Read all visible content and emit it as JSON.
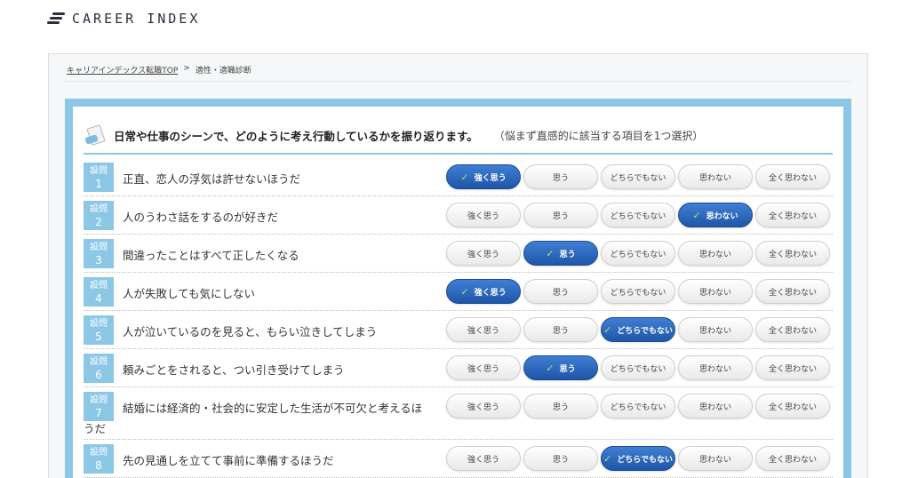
{
  "header": {
    "logo_text": "CAREER INDEX",
    "logo_icon": "stripes-logo-icon"
  },
  "breadcrumb": {
    "home": "キャリアインデックス転職TOP",
    "separator": ">",
    "current": "適性・適職診断"
  },
  "intro": {
    "icon": "notepad-icon",
    "main": "日常や仕事のシーンで、どのように考え行動しているかを振り返ります。",
    "sub": "（悩まず直感的に該当する項目を1つ選択）"
  },
  "question_label": "設問",
  "options": [
    "強く思う",
    "思う",
    "どちらでもない",
    "思わない",
    "全く思わない"
  ],
  "colors": {
    "accent_light": "#8cc8e6",
    "selected_blue": "#2a67bf",
    "check_green": "#a6e36a"
  },
  "questions": [
    {
      "num": "1",
      "text": "正直、恋人の浮気は許せないほうだ",
      "selected": 0
    },
    {
      "num": "2",
      "text": "人のうわさ話をするのが好きだ",
      "selected": 3
    },
    {
      "num": "3",
      "text": "間違ったことはすべて正したくなる",
      "selected": 1
    },
    {
      "num": "4",
      "text": "人が失敗しても気にしない",
      "selected": 0
    },
    {
      "num": "5",
      "text": "人が泣いているのを見ると、もらい泣きしてしまう",
      "selected": 2
    },
    {
      "num": "6",
      "text": "頼みごとをされると、つい引き受けてしまう",
      "selected": 1
    },
    {
      "num": "7",
      "text": "結婚には経済的・社会的に安定した生活が不可欠と考えるほ",
      "text_cont": "うだ",
      "selected": -1
    },
    {
      "num": "8",
      "text": "先の見通しを立てて事前に準備するほうだ",
      "selected": 2
    }
  ]
}
